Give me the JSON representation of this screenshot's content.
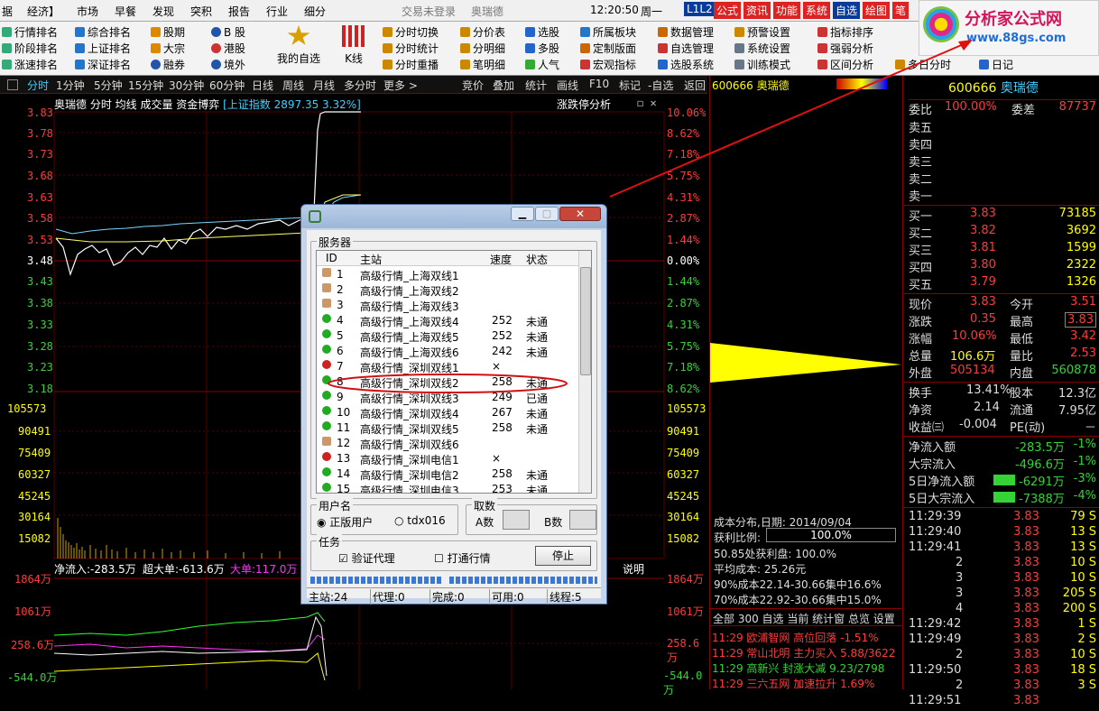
{
  "menu": {
    "items": [
      "据",
      "经济】",
      "市场",
      "早餐",
      "发现",
      "突积",
      "报告",
      "行业",
      "细分"
    ],
    "status": "交易未登录",
    "stock_name": "奥瑞德",
    "time": "12:20:50",
    "weekday": "周一",
    "right_tabs": [
      "L1L2",
      "公式",
      "资讯",
      "功能",
      "系统",
      "自选",
      "绘图",
      "笔"
    ]
  },
  "toolbar": {
    "col1": [
      "行情排名",
      "阶段排名",
      "涨速排名"
    ],
    "col2": [
      "综合排名",
      "上证排名",
      "深证排名"
    ],
    "col3": [
      "股期",
      "大宗",
      "融券"
    ],
    "col4": [
      "B 股",
      "港股",
      "境外"
    ],
    "big1": "我的自选",
    "big2": "K线",
    "col5": [
      "分时切换",
      "分时统计",
      "分时重播"
    ],
    "col6": [
      "分价表",
      "分明细",
      "笔明细"
    ],
    "col7": [
      "选股",
      "多股",
      "人气"
    ],
    "col8": [
      "所属板块",
      "定制版面",
      "宏观指标"
    ],
    "col9": [
      "数据管理",
      "自选管理",
      "选股系统"
    ],
    "col10": [
      "预警设置",
      "系统设置",
      "训练模式"
    ],
    "col11": [
      "指标排序",
      "强弱分析",
      "区间分析"
    ],
    "col12": [
      "",
      "多日分时",
      "日记"
    ]
  },
  "logo": {
    "text": "分析家公式网",
    "url": "www.88gs.com"
  },
  "tabs": {
    "left": [
      "分时",
      "1分钟",
      "5分钟",
      "15分钟",
      "30分钟",
      "60分钟",
      "日线",
      "周线",
      "月线",
      "多分时",
      "更多 >"
    ],
    "right": [
      "竞价",
      "叠加",
      "统计",
      "画线",
      "F10",
      "标记",
      "-自选",
      "返回"
    ]
  },
  "chart": {
    "header": "奥瑞德 分时 均线 成交量 资金博弈",
    "index": "[上证指数 2897.35 3.32%]",
    "limit_label": "涨跌停分析",
    "price_ticks": [
      "3.83",
      "3.78",
      "3.73",
      "3.68",
      "3.63",
      "3.58",
      "3.53",
      "3.48",
      "3.43",
      "3.38",
      "3.33",
      "3.28",
      "3.23",
      "3.18"
    ],
    "pct_ticks": [
      "10.06%",
      "8.62%",
      "7.18%",
      "5.75%",
      "4.31%",
      "2.87%",
      "1.44%",
      "0.00%",
      "1.44%",
      "2.87%",
      "4.31%",
      "5.75%",
      "7.18%",
      "8.62%"
    ],
    "vol_ticks": [
      "105573",
      "90491",
      "75409",
      "60327",
      "45245",
      "30164",
      "15082"
    ],
    "flow_label": "净流入:-283.5万",
    "super_label": "超大单:-613.6万",
    "big_label": "大单:117.0万",
    "explain": "说明",
    "flow_ticks": [
      "1864万",
      "1061万",
      "258.6万",
      "-544.0万"
    ]
  },
  "mid": {
    "code_name": "600666 奥瑞德",
    "dist_title": "成本分布,日期: 2014/09/04",
    "profit_label": "获利比例:",
    "profit_value": "100.0%",
    "line1": "50.85处获利盘: 100.0%",
    "line2": "平均成本: 25.26元",
    "line3": "90%成本22.14-30.66集中16.6%",
    "line4": "70%成本22.92-30.66集中15.0%",
    "news_tabs": "全部 300 自选 当前 统计窗 总览 设置",
    "news": [
      [
        "11:29",
        "欧浦智网",
        "高位回落",
        "-1.51%"
      ],
      [
        "11:29",
        "常山北明",
        "主力买入",
        "5.88/3622"
      ],
      [
        "11:29",
        "高新兴",
        "封涨大减",
        "9.23/2798"
      ],
      [
        "11:29",
        "三六五网",
        "加速拉升",
        "1.69%"
      ]
    ]
  },
  "quote": {
    "code": "600666",
    "name": "奥瑞德",
    "weibi_label": "委比",
    "weibi": "100.00%",
    "weicha_label": "委差",
    "weicha": "87737",
    "sells": [
      "卖五",
      "卖四",
      "卖三",
      "卖二",
      "卖一"
    ],
    "buys": [
      [
        "买一",
        "3.83",
        "73185"
      ],
      [
        "买二",
        "3.82",
        "3692"
      ],
      [
        "买三",
        "3.81",
        "1599"
      ],
      [
        "买四",
        "3.80",
        "2322"
      ],
      [
        "买五",
        "3.79",
        "1326"
      ]
    ],
    "stats": [
      [
        "现价",
        "3.83",
        "今开",
        "3.51"
      ],
      [
        "涨跌",
        "0.35",
        "最高",
        "3.83"
      ],
      [
        "涨幅",
        "10.06%",
        "最低",
        "3.42"
      ],
      [
        "总量",
        "106.6万",
        "量比",
        "2.53"
      ],
      [
        "外盘",
        "505134",
        "内盘",
        "560878"
      ]
    ],
    "stats2": [
      [
        "换手",
        "13.41%",
        "股本",
        "12.3亿"
      ],
      [
        "净资",
        "2.14",
        "流通",
        "7.95亿"
      ],
      [
        "收益㈢",
        "-0.004",
        "PE(动)",
        "－"
      ]
    ],
    "flows": [
      [
        "净流入额",
        "-283.5万",
        "-1%"
      ],
      [
        "大宗流入",
        "-496.6万",
        "-1%"
      ],
      [
        "5日净流入额",
        "-6291万",
        "-3%"
      ],
      [
        "5日大宗流入",
        "-7388万",
        "-4%"
      ]
    ],
    "ticks": [
      [
        "11:29:39",
        "3.83",
        "79 S"
      ],
      [
        "11:29:40",
        "3.83",
        "13 S"
      ],
      [
        "11:29:41",
        "3.83",
        "13 S"
      ],
      [
        "2",
        "3.83",
        "10 S"
      ],
      [
        "3",
        "3.83",
        "10 S"
      ],
      [
        "3",
        "3.83",
        "205 S"
      ],
      [
        "4",
        "3.83",
        "200 S"
      ],
      [
        "11:29:42",
        "3.83",
        "1 S"
      ],
      [
        "11:29:49",
        "3.83",
        "2 S"
      ],
      [
        "2",
        "3.83",
        "10 S"
      ],
      [
        "11:29:50",
        "3.83",
        "18 S"
      ],
      [
        "2",
        "3.83",
        "3 S"
      ],
      [
        "11:29:51",
        "3.83",
        ""
      ]
    ]
  },
  "dialog": {
    "group_server": "服务器",
    "cols": [
      "ID",
      "主站",
      "速度",
      "状态"
    ],
    "rows": [
      [
        "1",
        "高级行情_上海双线1",
        "",
        ""
      ],
      [
        "2",
        "高级行情_上海双线2",
        "",
        ""
      ],
      [
        "3",
        "高级行情_上海双线3",
        "",
        ""
      ],
      [
        "4",
        "高级行情_上海双线4",
        "252",
        "未通"
      ],
      [
        "5",
        "高级行情_上海双线5",
        "252",
        "未通"
      ],
      [
        "6",
        "高级行情_上海双线6",
        "242",
        "未通"
      ],
      [
        "7",
        "高级行情_深圳双线1",
        "×",
        ""
      ],
      [
        "8",
        "高级行情_深圳双线2",
        "258",
        "未通"
      ],
      [
        "9",
        "高级行情_深圳双线3",
        "249",
        "已通"
      ],
      [
        "10",
        "高级行情_深圳双线4",
        "267",
        "未通"
      ],
      [
        "11",
        "高级行情_深圳双线5",
        "258",
        "未通"
      ],
      [
        "12",
        "高级行情_深圳双线6",
        "",
        ""
      ],
      [
        "13",
        "高级行情_深圳电信1",
        "×",
        ""
      ],
      [
        "14",
        "高级行情_深圳电信2",
        "258",
        "未通"
      ],
      [
        "15",
        "高级行情_深圳电信3",
        "253",
        "未通"
      ]
    ],
    "group_user": "用户名",
    "radio1": "正版用户",
    "radio2": "tdx016",
    "group_count": "取数",
    "a_label": "A数",
    "b_label": "B数",
    "group_task": "任务",
    "check1": "验证代理",
    "check2": "打通行情",
    "stop_btn": "停止",
    "status": [
      [
        "主站:24"
      ],
      [
        "代理:0"
      ],
      [
        "完成:0"
      ],
      [
        "可用:0"
      ],
      [
        "线程:5"
      ]
    ]
  }
}
